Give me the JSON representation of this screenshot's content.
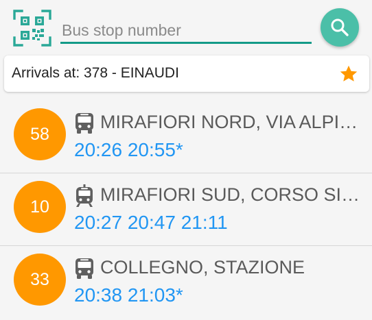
{
  "search": {
    "placeholder": "Bus stop number",
    "value": ""
  },
  "icons": {
    "qr": "qr-code-scanner-icon",
    "search": "search-icon",
    "favorite": "star-icon",
    "vehicle_bus": "bus-icon",
    "vehicle_tram": "tram-icon"
  },
  "colors": {
    "accent": "#139a88",
    "fab": "#4bbfa8",
    "badge": "#ff9800",
    "times": "#2196f3",
    "star": "#ff9800"
  },
  "stop": {
    "label": "Arrivals at: 378 - EINAUDI",
    "favorite": true
  },
  "routes": [
    {
      "line": "58",
      "vehicle": "bus",
      "destination": "MIRAFIORI NORD, VIA ALPIGNANO",
      "times": "20:26 20:55*"
    },
    {
      "line": "10",
      "vehicle": "tram",
      "destination": "MIRAFIORI SUD, CORSO SIRACUSA",
      "times": "20:27 20:47 21:11"
    },
    {
      "line": "33",
      "vehicle": "bus",
      "destination": "COLLEGNO, STAZIONE",
      "times": "20:38 21:03*"
    }
  ]
}
